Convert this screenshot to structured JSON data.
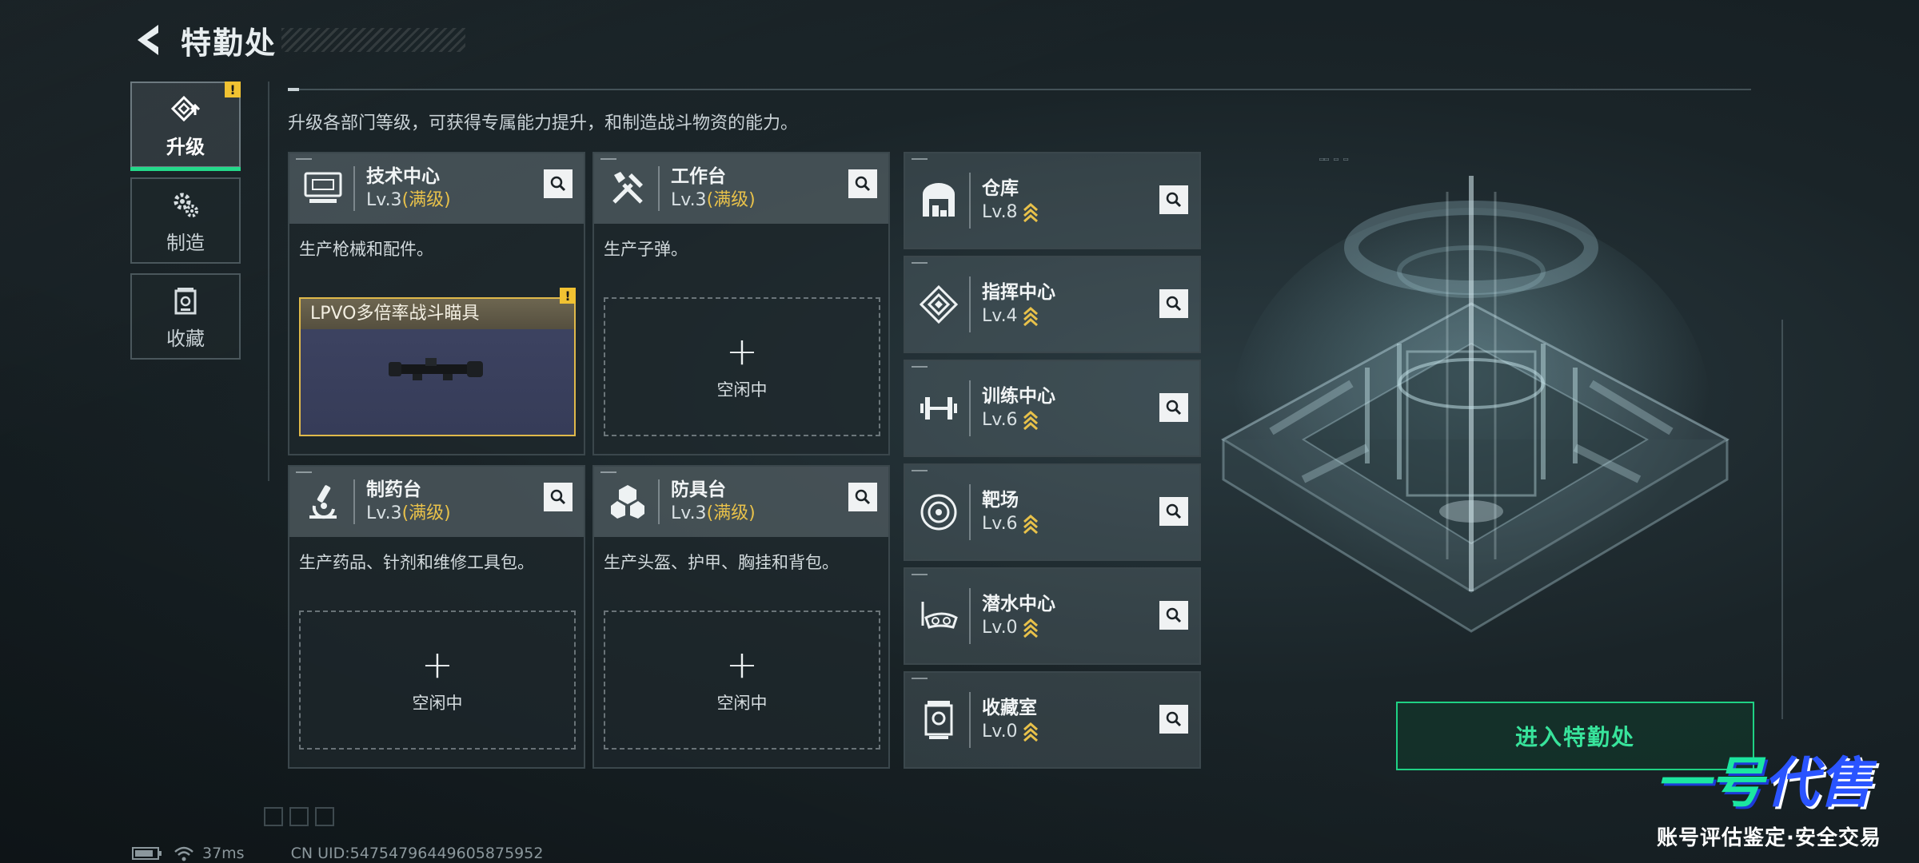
{
  "header": {
    "title": "特勤处"
  },
  "tabs": [
    {
      "label": "升级",
      "icon": "upgrade-icon",
      "active": true,
      "warning": "!"
    },
    {
      "label": "制造",
      "icon": "gears-icon",
      "active": false
    },
    {
      "label": "收藏",
      "icon": "collection-icon",
      "active": false
    }
  ],
  "subtitle": "升级各部门等级，可获得专属能力提升，和制造战斗物资的能力。",
  "departments": [
    {
      "name": "技术中心",
      "level": "Lv.3",
      "status": "(满级)",
      "icon": "monitor-icon",
      "desc": "生产枪械和配件。",
      "slot": {
        "type": "item",
        "item_name": "LPVO多倍率战斗瞄具",
        "warning": "!"
      }
    },
    {
      "name": "工作台",
      "level": "Lv.3",
      "status": "(满级)",
      "icon": "tools-icon",
      "desc": "生产子弹。",
      "slot": {
        "type": "empty",
        "label": "空闲中",
        "plus": "+"
      }
    },
    {
      "name": "制药台",
      "level": "Lv.3",
      "status": "(满级)",
      "icon": "microscope-icon",
      "desc": "生产药品、针剂和维修工具包。",
      "slot": {
        "type": "empty",
        "label": "空闲中",
        "plus": "+"
      }
    },
    {
      "name": "防具台",
      "level": "Lv.3",
      "status": "(满级)",
      "icon": "armor-boxes-icon",
      "desc": "生产头盔、护甲、胸挂和背包。",
      "slot": {
        "type": "empty",
        "label": "空闲中",
        "plus": "+"
      }
    }
  ],
  "facilities": [
    {
      "name": "仓库",
      "level": "Lv.8",
      "icon": "warehouse-icon"
    },
    {
      "name": "指挥中心",
      "level": "Lv.4",
      "icon": "command-icon"
    },
    {
      "name": "训练中心",
      "level": "Lv.6",
      "icon": "dumbbell-icon"
    },
    {
      "name": "靶场",
      "level": "Lv.6",
      "icon": "target-icon"
    },
    {
      "name": "潜水中心",
      "level": "Lv.0",
      "icon": "diving-mask-icon"
    },
    {
      "name": "收藏室",
      "level": "Lv.0",
      "icon": "collection-room-icon"
    }
  ],
  "enter_button": "进入特勤处",
  "status": {
    "ping": "37ms",
    "uid": "CN UID:5475479644960587595​2"
  },
  "watermark": {
    "logo_a": "一号",
    "logo_b": "代售",
    "tagline": "账号评估鉴定·安全交易"
  },
  "colors": {
    "accent_green": "#23d98a",
    "max_gold": "#e8c14a",
    "warning_yellow": "#f1c232"
  }
}
